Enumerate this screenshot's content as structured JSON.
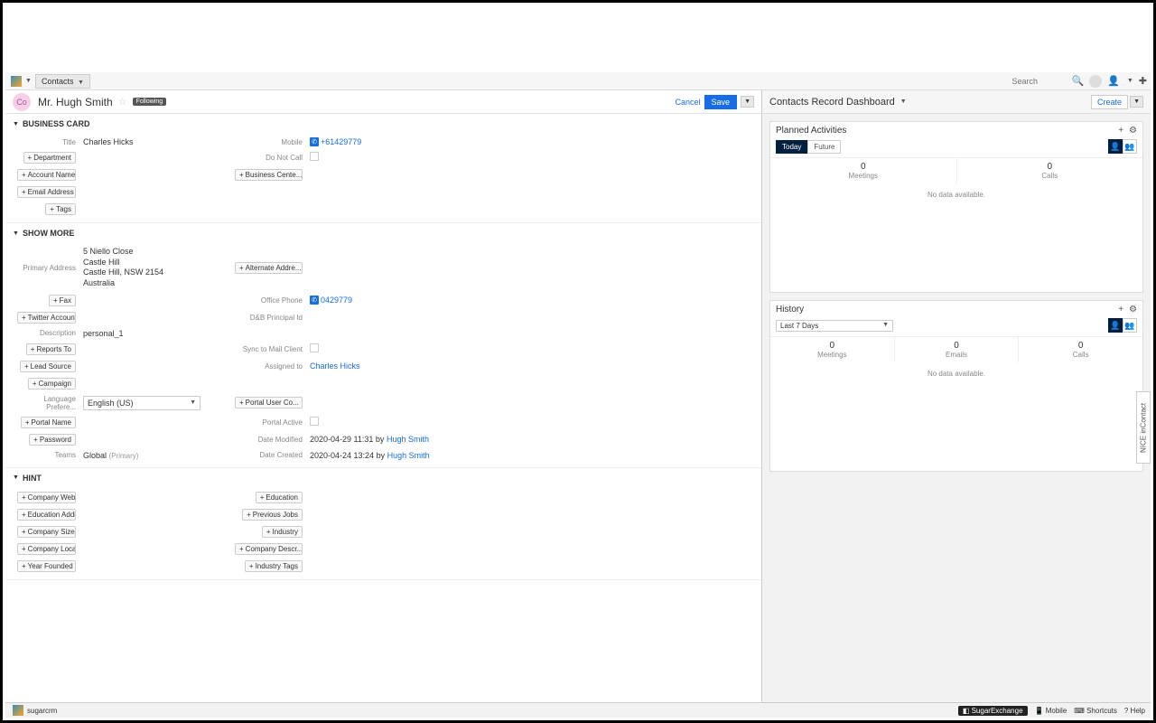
{
  "topbar": {
    "module_tab": "Contacts",
    "search_placeholder": "Search"
  },
  "record": {
    "avatar_initials": "Co",
    "name": "Mr. Hugh Smith",
    "following": "Following",
    "cancel": "Cancel",
    "save": "Save"
  },
  "panels": {
    "business_card": {
      "title": "BUSINESS CARD",
      "fields": {
        "title_label": "Title",
        "title_value": "Charles Hicks",
        "mobile_label": "Mobile",
        "mobile_value": "+61429779",
        "department_btn": "Department",
        "do_not_call_label": "Do Not Call",
        "account_name_btn": "Account Name",
        "business_center_btn": "Business Cente...",
        "email_address_btn": "Email Address",
        "tags_btn": "Tags"
      }
    },
    "show_more": {
      "title": "SHOW MORE",
      "fields": {
        "primary_address_label": "Primary Address",
        "addr_line1": "5 Niello Close",
        "addr_line2": "Castle Hill",
        "addr_line3": "Castle Hill, NSW 2154",
        "addr_line4": "Australia",
        "alternate_addr_btn": "Alternate Addre...",
        "fax_btn": "Fax",
        "office_phone_label": "Office Phone",
        "office_phone_value": "0429779",
        "twitter_btn": "Twitter Account",
        "dnb_label": "D&B Principal Id",
        "description_label": "Description",
        "description_value": "personal_1",
        "reports_to_btn": "Reports To",
        "sync_label": "Sync to Mail Client",
        "lead_source_btn": "Lead Source",
        "assigned_to_label": "Assigned to",
        "assigned_to_value": "Charles Hicks",
        "campaign_btn": "Campaign",
        "language_label": "Language Prefere...",
        "language_value": "English (US)",
        "portal_user_btn": "Portal User Co...",
        "portal_name_btn": "Portal Name",
        "portal_active_label": "Portal Active",
        "password_btn": "Password",
        "date_modified_label": "Date Modified",
        "date_modified_value": "2020-04-29 11:31",
        "date_modified_by": "by",
        "date_modified_user": "Hugh Smith",
        "teams_label": "Teams",
        "teams_value": "Global",
        "teams_primary": "(Primary)",
        "date_created_label": "Date Created",
        "date_created_value": "2020-04-24 13:24",
        "date_created_by": "by",
        "date_created_user": "Hugh Smith"
      }
    },
    "hint": {
      "title": "HINT",
      "fields": {
        "company_website_btn": "Company Websi...",
        "education_btn": "Education",
        "education_addl_btn": "Education Addit...",
        "previous_jobs_btn": "Previous Jobs",
        "company_size_btn": "Company Size",
        "industry_btn": "Industry",
        "company_location_btn": "Company Locati...",
        "company_descr_btn": "Company Descr...",
        "year_founded_btn": "Year Founded",
        "industry_tags_btn": "Industry Tags"
      }
    }
  },
  "dashboard": {
    "title": "Contacts Record Dashboard",
    "create": "Create",
    "planned": {
      "title": "Planned Activities",
      "tab_today": "Today",
      "tab_future": "Future",
      "meetings_count": "0",
      "meetings_label": "Meetings",
      "calls_count": "0",
      "calls_label": "Calls",
      "no_data": "No data available."
    },
    "history": {
      "title": "History",
      "filter": "Last 7 Days",
      "meetings_count": "0",
      "meetings_label": "Meetings",
      "emails_count": "0",
      "emails_label": "Emails",
      "calls_count": "0",
      "calls_label": "Calls",
      "no_data": "No data available."
    }
  },
  "footer": {
    "brand": "sugarcrm",
    "sugar_exchange": "SugarExchange",
    "mobile": "Mobile",
    "shortcuts": "Shortcuts",
    "help": "Help"
  },
  "side_tab": "NICE inContact"
}
